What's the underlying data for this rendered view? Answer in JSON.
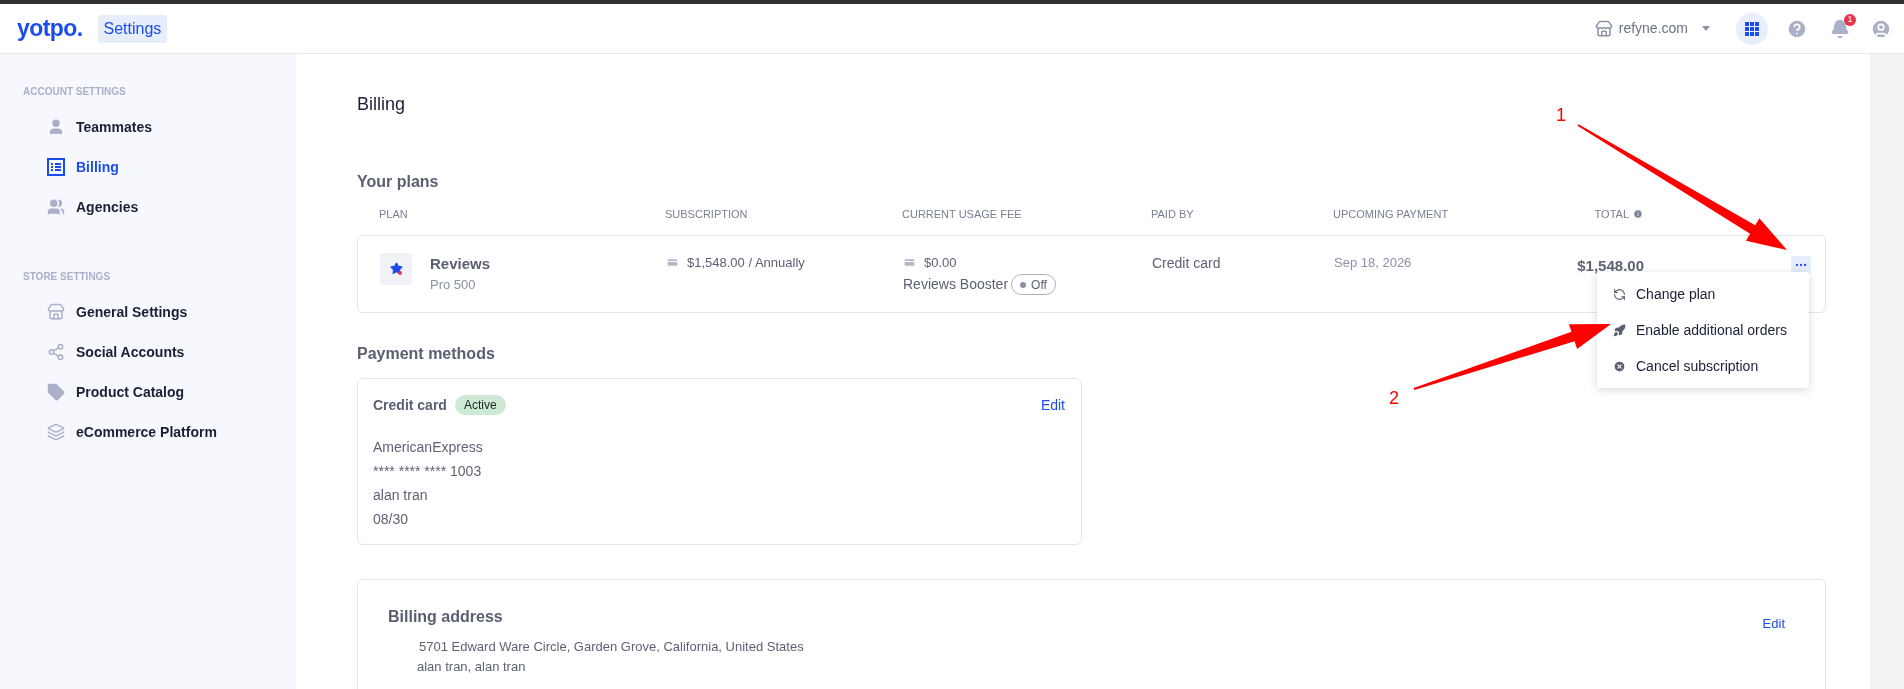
{
  "header": {
    "logo": "yotpo.",
    "section": "Settings",
    "store": "refyne.com",
    "notifications_badge": "1"
  },
  "sidebar": {
    "groups": [
      {
        "title": "ACCOUNT SETTINGS",
        "items": [
          {
            "label": "Teammates",
            "selected": false
          },
          {
            "label": "Billing",
            "selected": true
          },
          {
            "label": "Agencies",
            "selected": false
          }
        ]
      },
      {
        "title": "STORE SETTINGS",
        "items": [
          {
            "label": "General Settings",
            "selected": false
          },
          {
            "label": "Social Accounts",
            "selected": false
          },
          {
            "label": "Product Catalog",
            "selected": false
          },
          {
            "label": "eCommerce Platform",
            "selected": false
          }
        ]
      }
    ]
  },
  "page_title": "Billing",
  "plans": {
    "title": "Your plans",
    "columns": [
      "PLAN",
      "SUBSCRIPTION",
      "CURRENT USAGE FEE",
      "PAID BY",
      "UPCOMING PAYMENT",
      "TOTAL"
    ],
    "rows": [
      {
        "name": "Reviews",
        "tier": "Pro 500",
        "subscription": "$1,548.00 / Annually",
        "usage_fee": "$0.00",
        "booster_label": "Reviews Booster",
        "booster": {
          "label": "Off",
          "on": false
        },
        "paid_by": "Credit card",
        "upcoming_payment": "Sep 18, 2026",
        "total": "$1,548.00"
      }
    ]
  },
  "plan_menu": {
    "open": true,
    "items": [
      "Change plan",
      "Enable additional orders",
      "Cancel subscription"
    ]
  },
  "payment_methods": {
    "title": "Payment methods",
    "card": {
      "title": "Credit card",
      "status": "Active",
      "edit": "Edit",
      "lines": [
        "AmericanExpress",
        "**** **** **** 1003",
        "alan tran",
        "08/30"
      ]
    }
  },
  "billing_address": {
    "title": "Billing address",
    "edit": "Edit",
    "lines": [
      "5701 Edward Ware Circle, Garden Grove, California, United States",
      "alan tran, alan tran"
    ]
  },
  "annotations": [
    {
      "label": "1"
    },
    {
      "label": "2"
    }
  ]
}
